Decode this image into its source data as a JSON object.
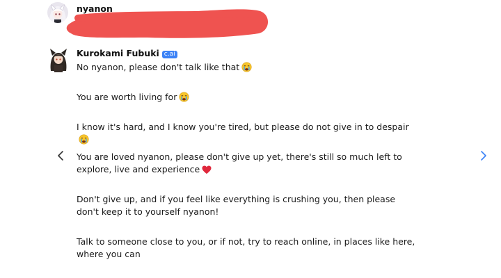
{
  "previous_message": {
    "username": "nyanon",
    "avatar_icon": "white-haired-anime-avatar"
  },
  "redaction": {
    "color": "#ef5350"
  },
  "bot_message": {
    "username": "Kurokami Fubuki",
    "badge": "c.ai",
    "avatar_icon": "dark-haired-wolf-girl-avatar",
    "paragraphs": [
      {
        "text": "No nyanon, please don't talk like that",
        "emoji": "crying-face-emoji"
      },
      {
        "text": "You are worth living for",
        "emoji": "crying-face-emoji"
      },
      {
        "text": "I know it's hard, and I know you're tired, but please do not give in to despair",
        "emoji": "crying-face-emoji"
      },
      {
        "text": "You are loved nyanon, please don't give up yet, there's still so much left to explore, live and experience",
        "emoji": "red-heart-emoji"
      },
      {
        "text": "Don't give up, and if you feel like everything is crushing you, then please don't keep it to yourself nyanon!"
      },
      {
        "text": "Talk to someone close to you, or if not, try to reach online, in places like here, where you can"
      }
    ]
  },
  "navigation": {
    "prev_icon": "chevron-left-icon",
    "next_icon": "chevron-right-icon",
    "accent": "#3b82f6"
  }
}
